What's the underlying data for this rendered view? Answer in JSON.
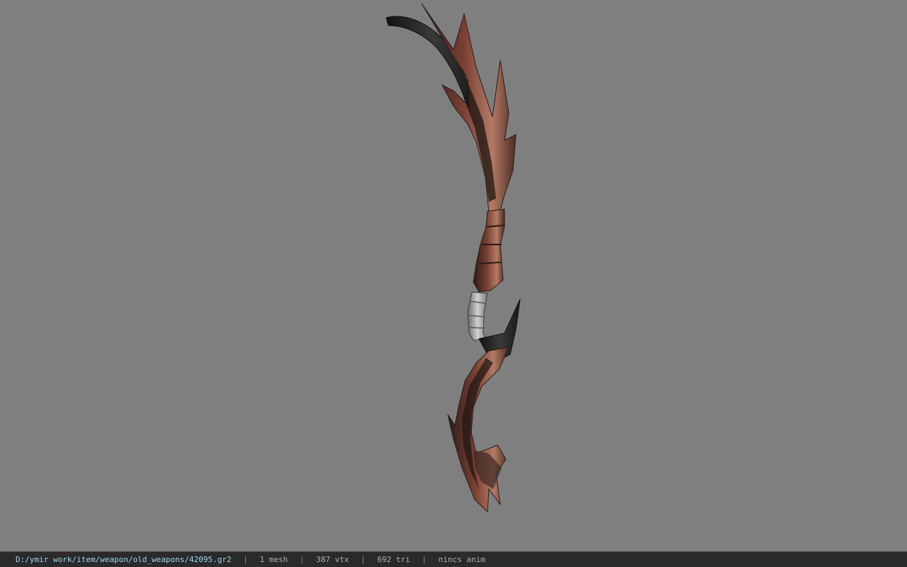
{
  "viewer": {
    "background": "#7f7f7f",
    "model_icon": "scythe-weapon-model"
  },
  "status": {
    "path": "D:/ymir work/item/weapon/old_weapons/42095.gr2",
    "separator": "|",
    "mesh": "1 mesh",
    "vertices": "387 vtx",
    "triangles": "692 tri",
    "anim": "nincs anim"
  }
}
